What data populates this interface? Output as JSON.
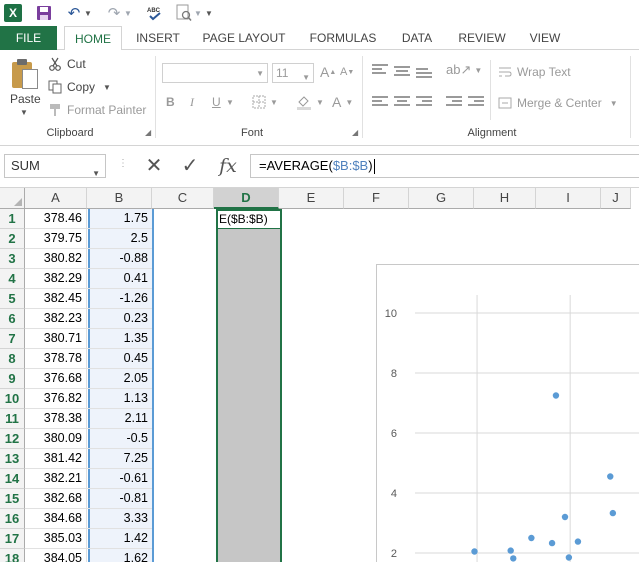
{
  "qat": {
    "app_logo": "X",
    "icons": [
      "excel-logo-icon",
      "save-icon",
      "undo-icon",
      "redo-icon",
      "spelling-icon",
      "print-preview-icon",
      "customize-qat-icon"
    ],
    "spelling_text": "ABC"
  },
  "tabs": [
    "FILE",
    "HOME",
    "INSERT",
    "PAGE LAYOUT",
    "FORMULAS",
    "DATA",
    "REVIEW",
    "VIEW"
  ],
  "active_tab": "HOME",
  "ribbon": {
    "clipboard": {
      "label": "Clipboard",
      "paste": "Paste",
      "cut": "Cut",
      "copy": "Copy",
      "format_painter": "Format Painter"
    },
    "font": {
      "label": "Font",
      "font_size": "11",
      "bold": "B",
      "italic": "I",
      "underline": "U",
      "font_color": "A"
    },
    "alignment": {
      "label": "Alignment",
      "wrap_text": "Wrap Text",
      "merge_center": "Merge & Center"
    }
  },
  "formula_bar": {
    "name_box": "SUM",
    "fx": "fx",
    "formula_prefix": "=AVERAGE(",
    "formula_ref": "$B:$B",
    "formula_suffix": ")"
  },
  "grid": {
    "columns": [
      "A",
      "B",
      "C",
      "D",
      "E",
      "F",
      "G",
      "H",
      "I",
      "J"
    ],
    "selected_column": "D",
    "rows": [
      "1",
      "2",
      "3",
      "4",
      "5",
      "6",
      "7",
      "8",
      "9",
      "10",
      "11",
      "12",
      "13",
      "14",
      "15",
      "16",
      "17",
      "18"
    ],
    "col_a": [
      "378.46",
      "379.75",
      "380.82",
      "382.29",
      "382.45",
      "382.23",
      "380.71",
      "378.78",
      "376.68",
      "376.82",
      "378.38",
      "380.09",
      "381.42",
      "382.21",
      "382.68",
      "384.68",
      "385.03",
      "384.05"
    ],
    "col_b": [
      "1.75",
      "2.5",
      "-0.88",
      "0.41",
      "-1.26",
      "0.23",
      "1.35",
      "0.45",
      "2.05",
      "1.13",
      "2.11",
      "-0.5",
      "7.25",
      "-0.61",
      "-0.81",
      "3.33",
      "1.42",
      "1.62"
    ],
    "d1_edit": "E($B:$B)"
  },
  "chart_data": {
    "type": "scatter",
    "title": "",
    "xlabel": "",
    "ylabel": "",
    "ytick_labels": [
      "2",
      "4",
      "6",
      "8",
      "10"
    ],
    "ylim": [
      2,
      10
    ],
    "xlim": [
      0,
      8.7
    ],
    "grid": true,
    "points": [
      [
        2.3,
        2.05
      ],
      [
        3.7,
        2.08
      ],
      [
        4.5,
        2.5
      ],
      [
        5.3,
        2.33
      ],
      [
        5.45,
        7.25
      ],
      [
        5.8,
        3.2
      ],
      [
        5.95,
        1.85
      ],
      [
        6.3,
        2.38
      ],
      [
        7.55,
        4.55
      ],
      [
        7.65,
        3.33
      ],
      [
        3.8,
        1.82
      ]
    ],
    "marker_color": "#5b9bd5"
  }
}
